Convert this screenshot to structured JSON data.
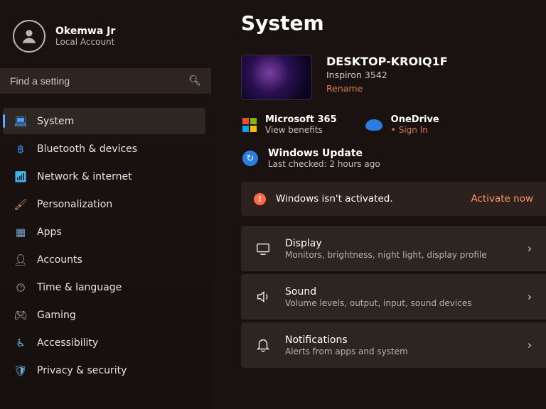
{
  "user": {
    "name": "Okemwa Jr",
    "sub": "Local Account"
  },
  "search": {
    "placeholder": "Find a setting"
  },
  "nav": {
    "system": "System",
    "bluetooth": "Bluetooth & devices",
    "network": "Network & internet",
    "personal": "Personalization",
    "apps": "Apps",
    "accounts": "Accounts",
    "time": "Time & language",
    "gaming": "Gaming",
    "access": "Accessibility",
    "privacy": "Privacy & security"
  },
  "page": {
    "title": "System"
  },
  "device": {
    "name": "DESKTOP-KROIQ1F",
    "model": "Inspiron 3542",
    "rename": "Rename"
  },
  "m365": {
    "title": "Microsoft 365",
    "sub": "View benefits"
  },
  "onedrive": {
    "title": "OneDrive",
    "link": "Sign In",
    "bullet": "•"
  },
  "update": {
    "title": "Windows Update",
    "sub": "Last checked: 2 hours ago"
  },
  "activation": {
    "text": "Windows isn't activated.",
    "link": "Activate now"
  },
  "settings": {
    "display": {
      "title": "Display",
      "sub": "Monitors, brightness, night light, display profile"
    },
    "sound": {
      "title": "Sound",
      "sub": "Volume levels, output, input, sound devices"
    },
    "notif": {
      "title": "Notifications",
      "sub": "Alerts from apps and system"
    }
  }
}
